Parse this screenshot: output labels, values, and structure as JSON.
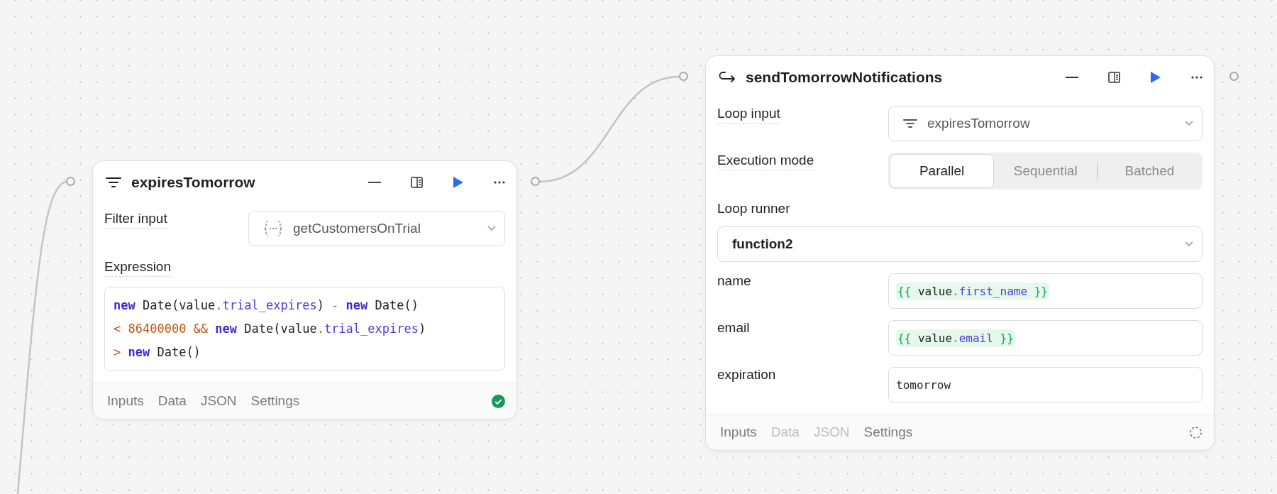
{
  "nodes": [
    {
      "title": "expiresTomorrow",
      "fields": [
        {
          "kind": "select",
          "label": "Filter input",
          "value": "getCustomersOnTrial"
        },
        {
          "kind": "code",
          "label": "Expression",
          "lines": [
            [
              {
                "kind": "keyword",
                "text": "new"
              },
              {
                "kind": "plain",
                "text": " Date(value"
              },
              {
                "kind": "operator",
                "text": "."
              },
              {
                "kind": "property",
                "text": "trial_expires"
              },
              {
                "kind": "plain",
                "text": ") "
              },
              {
                "kind": "operator",
                "text": "- "
              },
              {
                "kind": "keyword",
                "text": "new"
              },
              {
                "kind": "plain",
                "text": " Date()"
              }
            ],
            [
              {
                "kind": "operator",
                "text": "< "
              },
              {
                "kind": "number",
                "text": "86400000 "
              },
              {
                "kind": "operator",
                "text": "&& "
              },
              {
                "kind": "keyword",
                "text": "new"
              },
              {
                "kind": "plain",
                "text": " Date(value"
              },
              {
                "kind": "operator",
                "text": "."
              },
              {
                "kind": "property",
                "text": "trial_expires"
              },
              {
                "kind": "plain",
                "text": ")"
              }
            ],
            [
              {
                "kind": "operator",
                "text": "> "
              },
              {
                "kind": "keyword",
                "text": "new"
              },
              {
                "kind": "plain",
                "text": " Date()"
              }
            ]
          ]
        }
      ],
      "tabs": [
        {
          "label": "Inputs",
          "disabled": false
        },
        {
          "label": "Data",
          "disabled": false
        },
        {
          "label": "JSON",
          "disabled": false
        },
        {
          "label": "Settings",
          "disabled": false
        }
      ],
      "complete": true
    },
    {
      "title": "sendTomorrowNotifications",
      "fields": [
        {
          "kind": "select",
          "label": "Loop input",
          "value": "expiresTomorrow"
        },
        {
          "kind": "segmented",
          "label": "Execution mode",
          "options": [
            {
              "label": "Parallel",
              "selected": true
            },
            {
              "label": "Sequential",
              "selected": false
            },
            {
              "label": "Batched",
              "selected": false
            }
          ]
        },
        {
          "kind": "stacked-select",
          "label": "Loop runner",
          "value": "function2"
        },
        {
          "kind": "template",
          "label": "name",
          "tokens": [
            {
              "kind": "brace",
              "text": "{{"
            },
            {
              "kind": "plain",
              "text": " value"
            },
            {
              "kind": "operator",
              "text": "."
            },
            {
              "kind": "property",
              "text": "first_name"
            },
            {
              "kind": "brace",
              "text": " }}"
            }
          ]
        },
        {
          "kind": "template",
          "label": "email",
          "tokens": [
            {
              "kind": "brace",
              "text": "{{"
            },
            {
              "kind": "plain",
              "text": " value"
            },
            {
              "kind": "operator",
              "text": "."
            },
            {
              "kind": "property",
              "text": "email"
            },
            {
              "kind": "brace",
              "text": " }}"
            }
          ]
        },
        {
          "kind": "text",
          "label": "expiration",
          "value": "tomorrow"
        }
      ],
      "tabs": [
        {
          "label": "Inputs",
          "disabled": false
        },
        {
          "label": "Data",
          "disabled": true
        },
        {
          "label": "JSON",
          "disabled": true
        },
        {
          "label": "Settings",
          "disabled": false
        }
      ],
      "complete": false
    }
  ]
}
